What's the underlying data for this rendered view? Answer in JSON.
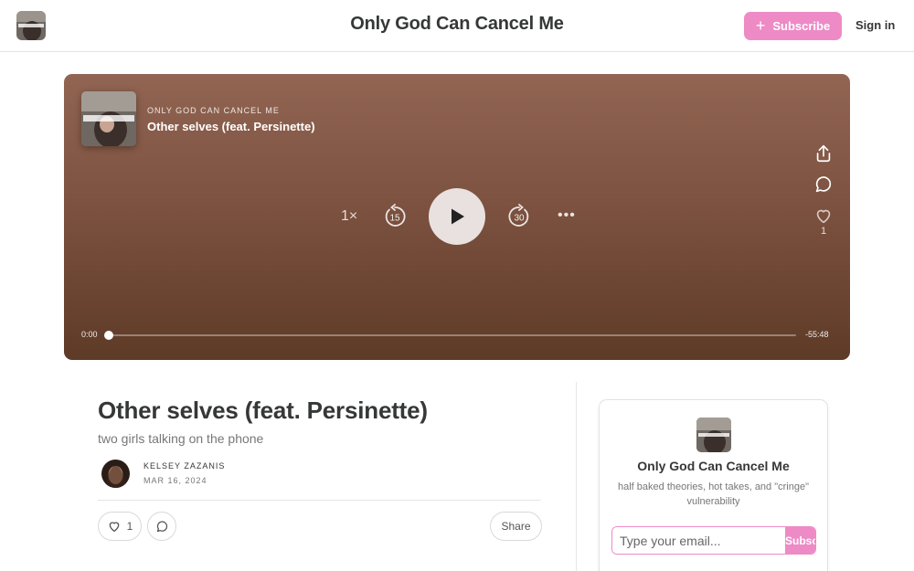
{
  "header": {
    "site_title": "Only God Can Cancel Me",
    "subscribe_label": "Subscribe",
    "signin_label": "Sign in",
    "logo_icon": "publication-logo"
  },
  "player": {
    "publication": "ONLY GOD CAN CANCEL ME",
    "episode_title": "Other selves (feat. Persinette)",
    "speed": "1×",
    "skip_back_seconds": "15",
    "skip_forward_seconds": "30",
    "elapsed": "0:00",
    "remaining": "-55:48",
    "progress_fraction": 0,
    "like_count": "1",
    "icons": [
      "share-icon",
      "comment-icon",
      "heart-icon",
      "play-icon",
      "more-icon"
    ]
  },
  "post": {
    "title": "Other selves (feat. Persinette)",
    "subtitle": "two girls talking on the phone",
    "author": "KELSEY ZAZANIS",
    "date": "MAR 16, 2024",
    "like_count": "1",
    "share_label": "Share"
  },
  "sidebar": {
    "title": "Only God Can Cancel Me",
    "description": "half baked theories, hot takes, and \"cringe\" vulnerability",
    "email_placeholder": "Type your email...",
    "subscribe_label": "Subscribe"
  },
  "colors": {
    "accent": "#ee8ac6",
    "player_top": "#926553",
    "player_bottom": "#5e3b27"
  }
}
